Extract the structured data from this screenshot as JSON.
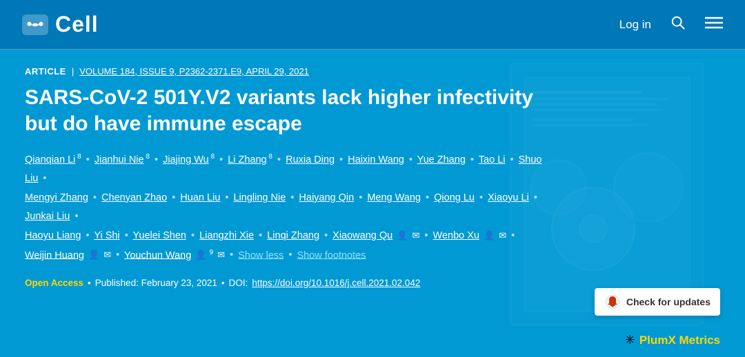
{
  "header": {
    "logo_text": "Cell",
    "login_label": "Log in",
    "search_icon": "search-icon",
    "menu_icon": "menu-icon"
  },
  "article": {
    "badge": "ARTICLE",
    "meta_info": "VOLUME 184, ISSUE 9, P2362-2371.E9, APRIL 29, 2021",
    "title": "SARS-CoV-2 501Y.V2 variants lack higher infectivity but do have immune escape",
    "authors_line1": [
      {
        "name": "Qianqian Li",
        "sup": "8"
      },
      {
        "name": "Jianhui Nie",
        "sup": "8"
      },
      {
        "name": "Jiajing Wu",
        "sup": "8"
      },
      {
        "name": "Li Zhang",
        "sup": "8"
      },
      {
        "name": "Ruxia Ding",
        "sup": ""
      },
      {
        "name": "Haixin Wang",
        "sup": ""
      },
      {
        "name": "Yue Zhang",
        "sup": ""
      },
      {
        "name": "Tao Li",
        "sup": ""
      },
      {
        "name": "Shuo Liu",
        "sup": ""
      }
    ],
    "authors_line2": [
      {
        "name": "Mengyi Zhang",
        "sup": ""
      },
      {
        "name": "Chenyan Zhao",
        "sup": ""
      },
      {
        "name": "Huan Liu",
        "sup": ""
      },
      {
        "name": "Lingling Nie",
        "sup": ""
      },
      {
        "name": "Haiyang Qin",
        "sup": ""
      },
      {
        "name": "Meng Wang",
        "sup": ""
      },
      {
        "name": "Qiong Lu",
        "sup": ""
      },
      {
        "name": "Xiaoyu Li",
        "sup": ""
      },
      {
        "name": "Junkai Liu",
        "sup": ""
      }
    ],
    "authors_line3": [
      {
        "name": "Haoyu Liang",
        "sup": ""
      },
      {
        "name": "Yi Shi",
        "sup": ""
      },
      {
        "name": "Yuelei Shen",
        "sup": ""
      },
      {
        "name": "Liangzhi Xie",
        "sup": ""
      },
      {
        "name": "Linqi Zhang",
        "sup": ""
      },
      {
        "name": "Xiaowang Qu",
        "sup": "",
        "icons": true
      },
      {
        "name": "Wenbo Xu",
        "sup": "",
        "icons": true
      }
    ],
    "authors_line4": [
      {
        "name": "Weijin Huang",
        "sup": "",
        "icons": true
      },
      {
        "name": "Youchun Wang",
        "sup": "9",
        "icons": true
      }
    ],
    "show_less_label": "Show less",
    "show_footnotes_label": "Show footnotes",
    "open_access": "Open Access",
    "published": "Published: February 23, 2021",
    "doi_label": "DOI:",
    "doi_link": "https://doi.org/10.1016/j.cell.2021.02.042",
    "check_updates_label": "Check for updates",
    "plumx_label": "PlumX Metrics"
  }
}
